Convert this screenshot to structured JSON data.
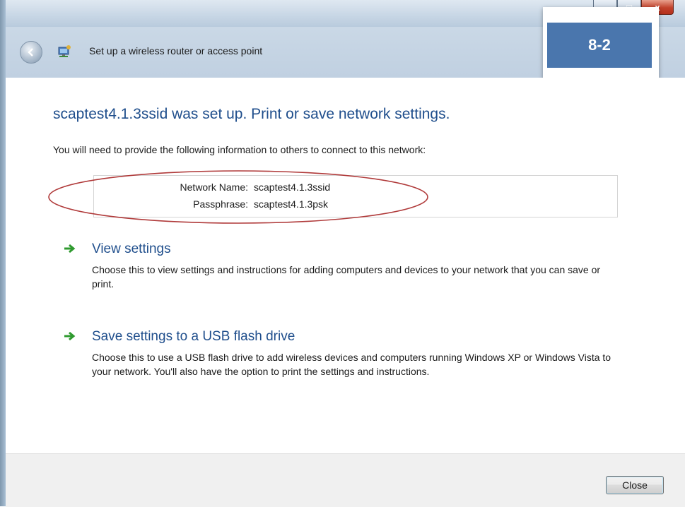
{
  "window": {
    "title": "Set up a wireless router or access point",
    "caption_buttons": {
      "minimize": "–",
      "maximize": "□",
      "close": "x"
    }
  },
  "badge": {
    "label": "8-2",
    "color": "#4a76ad"
  },
  "content": {
    "heading": "scaptest4.1.3ssid was set up.  Print or save network settings.",
    "intro": "You will need to provide the following information to others to connect to this network:",
    "network_info": {
      "name_label": "Network Name:",
      "name_value": "scaptest4.1.3ssid",
      "passphrase_label": "Passphrase:",
      "passphrase_value": "scaptest4.1.3psk"
    },
    "options": [
      {
        "title": "View settings",
        "description": "Choose this to view settings and instructions for adding computers and devices to your network that you can save or print.",
        "icon": "green-arrow-icon"
      },
      {
        "title": "Save settings to a USB flash drive",
        "description": "Choose this to use a USB flash drive to add wireless devices and computers running Windows XP or Windows Vista to your network. You'll also have the option to print the settings and instructions.",
        "icon": "green-arrow-icon"
      }
    ]
  },
  "footer": {
    "close_label": "Close"
  },
  "colors": {
    "heading": "#1f4e8c",
    "arrow": "#2f9a2f",
    "annotation": "#b03a3a"
  }
}
